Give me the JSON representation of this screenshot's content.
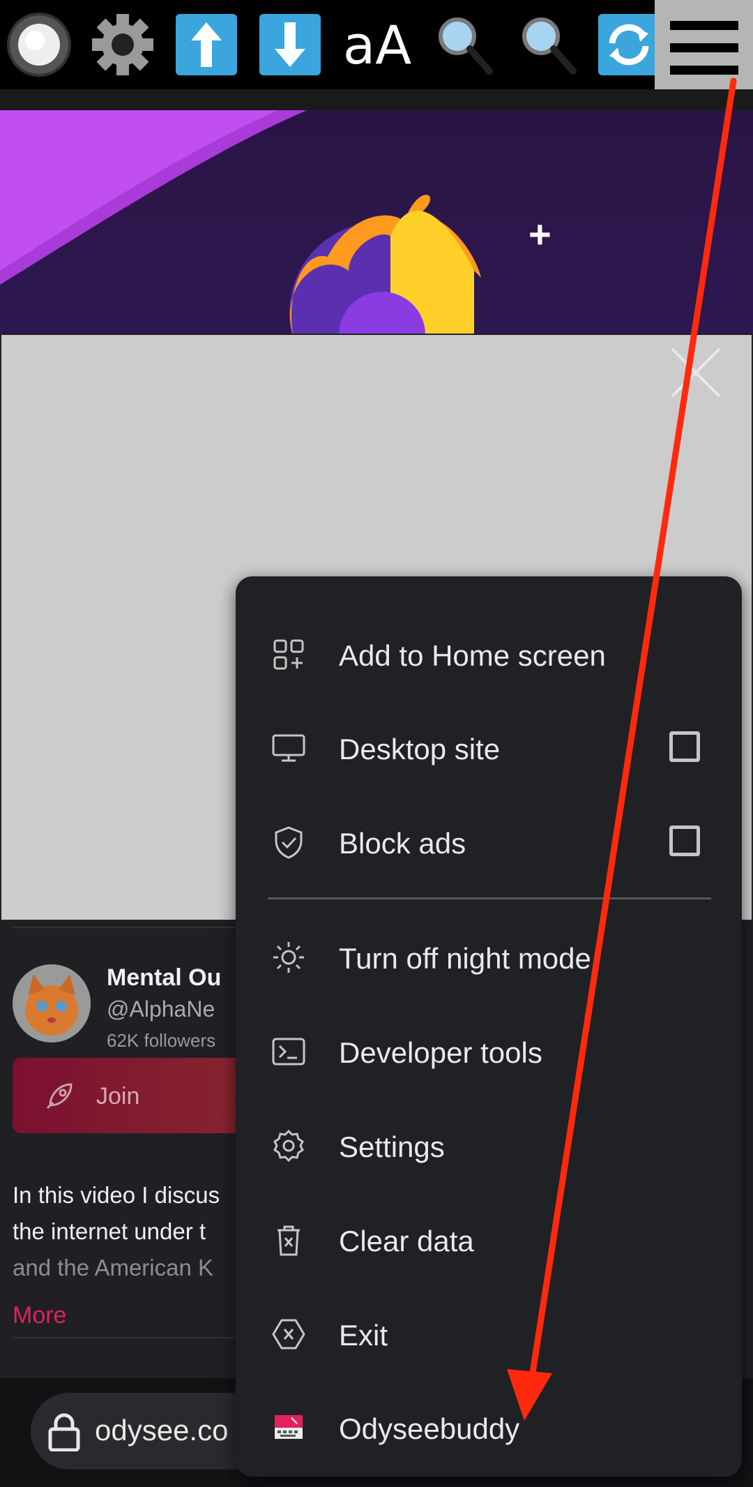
{
  "toolbar": {
    "buttons": [
      {
        "name": "record-button",
        "icon": "record-icon"
      },
      {
        "name": "settings-button",
        "icon": "gear-icon"
      },
      {
        "name": "scroll-up-button",
        "icon": "arrow-up-icon"
      },
      {
        "name": "scroll-down-button",
        "icon": "arrow-down-icon"
      },
      {
        "name": "text-size-button",
        "label": "aA"
      },
      {
        "name": "zoom-in-button",
        "icon": "magnifier-icon"
      },
      {
        "name": "zoom-out-button",
        "icon": "magnifier-icon"
      },
      {
        "name": "refresh-button",
        "icon": "refresh-icon"
      },
      {
        "name": "menu-button",
        "icon": "hamburger-icon"
      }
    ],
    "text_size_label": "aA"
  },
  "hero": {
    "plus_label": "+"
  },
  "channel": {
    "name": "Mental Ou",
    "handle": "@AlphaNe",
    "followers": "62K followers",
    "join_label": "Join",
    "description": [
      "In this video I discus",
      "the internet under t",
      "and the American K"
    ],
    "more_label": "More"
  },
  "address_bar": {
    "url": "odysee.co"
  },
  "menu": {
    "items": [
      {
        "label": "Add to Home screen",
        "icon": "add-to-home-icon"
      },
      {
        "label": "Desktop site",
        "icon": "monitor-icon",
        "checkbox": false
      },
      {
        "label": "Block ads",
        "icon": "shield-check-icon",
        "checkbox": false
      },
      {
        "label": "Turn off night mode",
        "icon": "sun-icon"
      },
      {
        "label": "Developer tools",
        "icon": "terminal-icon"
      },
      {
        "label": "Settings",
        "icon": "gear-icon"
      },
      {
        "label": "Clear data",
        "icon": "trash-icon"
      },
      {
        "label": "Exit",
        "icon": "exit-icon"
      },
      {
        "label": "Odyseebuddy",
        "icon": "odyseebuddy-icon"
      }
    ]
  },
  "colors": {
    "accent": "#e2215d",
    "arrow": "#ff2a0e",
    "menu_bg": "#202124",
    "overlay": "#cccccc"
  }
}
